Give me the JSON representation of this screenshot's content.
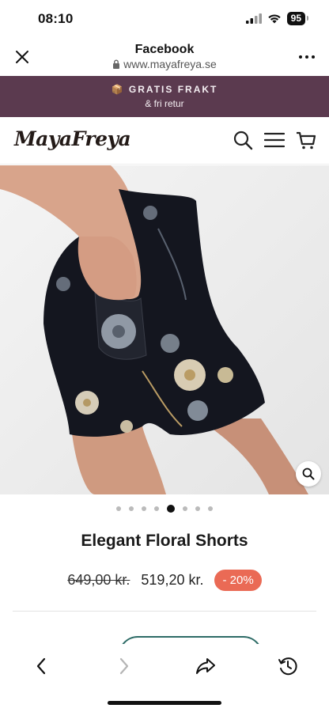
{
  "status_bar": {
    "time": "08:10",
    "battery": "95"
  },
  "browser": {
    "title": "Facebook",
    "url": "www.mayafreya.se"
  },
  "promo": {
    "line1": "📦 GRATIS FRAKT",
    "line2": "& fri retur"
  },
  "site": {
    "logo": "MayaFreya"
  },
  "carousel": {
    "total": 8,
    "active_index": 4
  },
  "product": {
    "title": "Elegant Floral Shorts",
    "old_price": "649,00 kr.",
    "price": "519,20 kr.",
    "discount": "- 20%"
  },
  "colors": {
    "promo_bg": "#5b3a4f",
    "discount_bg": "#ea6a55",
    "accent": "#2d6b66"
  }
}
